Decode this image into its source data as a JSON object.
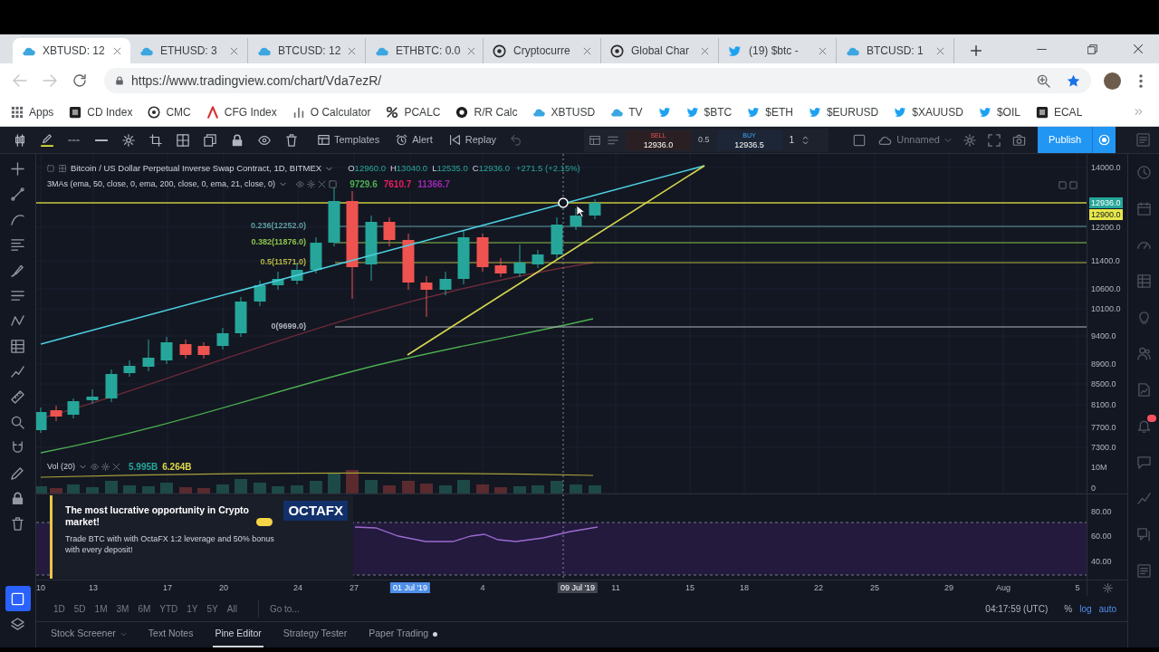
{
  "browser": {
    "tabs": [
      {
        "title": "XBTUSD: 12",
        "selected": true
      },
      {
        "title": "ETHUSD: 3",
        "selected": false
      },
      {
        "title": "BTCUSD: 12",
        "selected": false
      },
      {
        "title": "ETHBTC: 0.0",
        "selected": false
      },
      {
        "title": "Cryptocurre",
        "selected": false
      },
      {
        "title": "Global Char",
        "selected": false
      },
      {
        "title": "(19) $btc -",
        "selected": false
      },
      {
        "title": "BTCUSD: 1",
        "selected": false
      }
    ],
    "url": "https://www.tradingview.com/chart/Vda7ezR/",
    "bookmarks": [
      {
        "kind": "link",
        "label": "Apps"
      },
      {
        "kind": "link",
        "label": "CD Index"
      },
      {
        "kind": "link",
        "label": "CMC"
      },
      {
        "kind": "link",
        "label": "CFG Index"
      },
      {
        "kind": "link",
        "label": "O Calculator"
      },
      {
        "kind": "link",
        "label": "PCALC"
      },
      {
        "kind": "link",
        "label": "R/R Calc"
      },
      {
        "kind": "link",
        "label": "XBTUSD"
      },
      {
        "kind": "link",
        "label": "TV"
      },
      {
        "kind": "icon"
      },
      {
        "kind": "link",
        "label": "$BTC"
      },
      {
        "kind": "link",
        "label": "$ETH"
      },
      {
        "kind": "link",
        "label": "$EURUSD"
      },
      {
        "kind": "link",
        "label": "$XAUUSD"
      },
      {
        "kind": "link",
        "label": "$OIL"
      },
      {
        "kind": "link",
        "label": "ECAL"
      }
    ]
  },
  "toolbar": {
    "buttons": [
      "Templates",
      "Alert",
      "Replay"
    ],
    "trade": {
      "sell_label": "SELL",
      "sell_price": "12936.0",
      "spread": "0.5",
      "buy_label": "BUY",
      "buy_price": "12936.5",
      "quantity": "1"
    },
    "layout": "Unnamed",
    "publish": "Publish"
  },
  "left_toolbar": [
    {
      "selected": false
    },
    {
      "selected": false
    },
    {
      "selected": false
    },
    {
      "selected": false
    },
    {
      "selected": false
    },
    {
      "selected": false
    },
    {
      "selected": false
    },
    {
      "selected": false
    },
    {
      "selected": false
    },
    {
      "selected": false
    },
    {
      "selected": false
    },
    {
      "selected": false
    },
    {
      "selected": false
    },
    {
      "selected": false
    },
    {
      "selected": false
    },
    {
      "selected": true
    },
    {
      "selected": false
    }
  ],
  "chart": {
    "title": "Bitcoin / US Dollar Perpetual Inverse Swap Contract, 1D, BITMEX",
    "ohlc": [
      {
        "label": "O",
        "value": "12960.0"
      },
      {
        "label": "H",
        "value": "13040.0"
      },
      {
        "label": "L",
        "value": "12535.0"
      },
      {
        "label": "C",
        "value": "12936.0"
      }
    ],
    "change": "+271.5 (+2.15%)",
    "indicator": {
      "label": "3MAs (ema, 50, close, 0, ema, 200, close, 0, ema, 21, close, 0)",
      "values": [
        {
          "value": "9729.6",
          "color": "#4caf50"
        },
        {
          "value": "7610.7",
          "color": "#e91e63"
        },
        {
          "value": "11366.7",
          "color": "#9c27b0"
        }
      ]
    },
    "fib_levels": [
      {
        "label": "0.236(12252.0)",
        "color": "#5f9ea0"
      },
      {
        "label": "0.382(11876.0)",
        "color": "#8bc34a"
      },
      {
        "label": "0.5(11571.0)",
        "color": "#b5b542"
      },
      {
        "label": "0(9699.0)",
        "color": "#b2b5be"
      }
    ],
    "volume": {
      "label": "Vol (20)",
      "values": [
        {
          "value": "5.995B",
          "color": "#26a69a"
        },
        {
          "value": "6.264B",
          "color": "#e0d94a"
        }
      ]
    }
  },
  "price_axis": [
    {
      "kind": "tick",
      "label": "14000.0"
    },
    {
      "kind": "last",
      "label": "12936.0"
    },
    {
      "kind": "line",
      "label": "12900.0"
    },
    {
      "kind": "tick",
      "label": "12200.0"
    },
    {
      "kind": "tick",
      "label": "11400.0"
    },
    {
      "kind": "tick",
      "label": "10600.0"
    },
    {
      "kind": "tick",
      "label": "10100.0"
    },
    {
      "kind": "tick",
      "label": "9400.0"
    },
    {
      "kind": "tick",
      "label": "8900.0"
    },
    {
      "kind": "tick",
      "label": "8500.0"
    },
    {
      "kind": "tick",
      "label": "8100.0"
    },
    {
      "kind": "tick",
      "label": "7700.0"
    },
    {
      "kind": "tick",
      "label": "7300.0"
    },
    {
      "kind": "tick",
      "label": "10M"
    },
    {
      "kind": "tick",
      "label": "0"
    },
    {
      "kind": "tick",
      "label": "80.00"
    },
    {
      "kind": "tick",
      "label": "60.00"
    },
    {
      "kind": "tick",
      "label": "40.00"
    }
  ],
  "time_axis": [
    {
      "kind": "tick",
      "label": "10"
    },
    {
      "kind": "tick",
      "label": "13"
    },
    {
      "kind": "tick",
      "label": "17"
    },
    {
      "kind": "tick",
      "label": "20"
    },
    {
      "kind": "tick",
      "label": "24"
    },
    {
      "kind": "tick",
      "label": "27"
    },
    {
      "kind": "range",
      "label": "01 Jul '19"
    },
    {
      "kind": "tick",
      "label": "4"
    },
    {
      "kind": "cursor",
      "label": "09 Jul '19"
    },
    {
      "kind": "tick",
      "label": "11"
    },
    {
      "kind": "tick",
      "label": "15"
    },
    {
      "kind": "tick",
      "label": "18"
    },
    {
      "kind": "tick",
      "label": "22"
    },
    {
      "kind": "tick",
      "label": "25"
    },
    {
      "kind": "tick",
      "label": "29"
    },
    {
      "kind": "tick",
      "label": "Aug"
    },
    {
      "kind": "tick",
      "label": "5"
    }
  ],
  "range_buttons": [
    {
      "label": "1D",
      "selected": false
    },
    {
      "label": "5D",
      "selected": false
    },
    {
      "label": "1M",
      "selected": false
    },
    {
      "label": "3M",
      "selected": false
    },
    {
      "label": "6M",
      "selected": false
    },
    {
      "label": "YTD",
      "selected": false
    },
    {
      "label": "1Y",
      "selected": false
    },
    {
      "label": "5Y",
      "selected": false
    },
    {
      "label": "All",
      "selected": false
    }
  ],
  "goto": "Go to...",
  "clock": "04:17:59 (UTC)",
  "scale_buttons": [
    {
      "label": "%",
      "selected": false
    },
    {
      "label": "log",
      "selected": true
    },
    {
      "label": "auto",
      "selected": true
    }
  ],
  "ad": {
    "title": "The most lucrative opportunity in Crypto market!",
    "body": "Trade BTC with with OctaFX 1:2 leverage and 50% bonus with every deposit!",
    "logo": "OCTAFX"
  },
  "bottom_tabs": [
    {
      "kind": "menu",
      "label": "Stock Screener",
      "selected": false
    },
    {
      "kind": "tab",
      "label": "Text Notes",
      "selected": false
    },
    {
      "kind": "tab",
      "label": "Pine Editor",
      "selected": true
    },
    {
      "kind": "tab",
      "label": "Strategy Tester",
      "selected": false
    },
    {
      "kind": "status",
      "label": "Paper Trading",
      "selected": false
    }
  ]
}
